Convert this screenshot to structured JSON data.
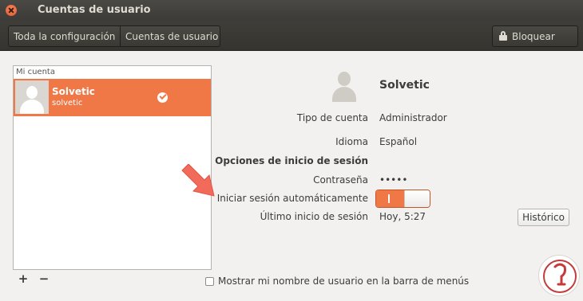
{
  "window": {
    "title": "Cuentas de usuario"
  },
  "toolbar": {
    "breadcrumb_all": "Toda la configuración",
    "breadcrumb_current": "Cuentas de usuario",
    "lock_label": "Bloquear"
  },
  "accounts": {
    "header": "Mi cuenta",
    "items": [
      {
        "name": "Solvetic",
        "login": "solvetic",
        "selected": true
      }
    ],
    "add_label": "+",
    "remove_label": "−"
  },
  "details": {
    "name": "Solvetic",
    "tipo_label": "Tipo de cuenta",
    "tipo_value": "Administrador",
    "idioma_label": "Idioma",
    "idioma_value": "Español",
    "section_title": "Opciones de inicio de sesión",
    "password_label": "Contraseña",
    "password_value": "•••••",
    "autologin_label": "Iniciar sesión automáticamente",
    "autologin_on": true,
    "last_login_label": "Último inicio de sesión",
    "last_login_value": "Hoy,  5:27",
    "history_button": "Histórico"
  },
  "footer": {
    "show_name_label": "Mostrar mi nombre de usuario en la barra de menús",
    "show_name_checked": false
  },
  "colors": {
    "accent": "#f07746",
    "toolbar": "#3c3b37",
    "annotation_arrow": "#f26a5a"
  }
}
